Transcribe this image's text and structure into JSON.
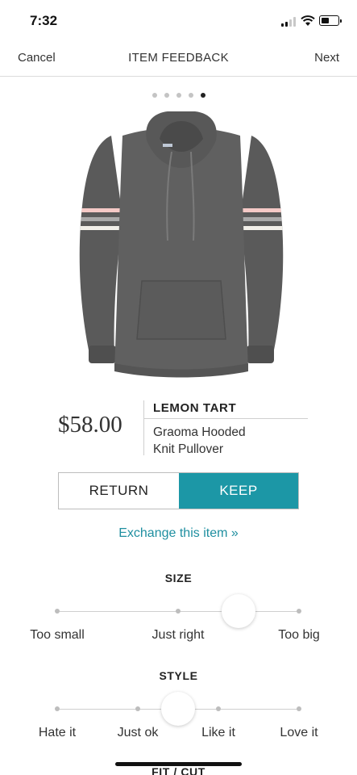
{
  "status_bar": {
    "time": "7:32"
  },
  "nav": {
    "cancel": "Cancel",
    "title": "ITEM FEEDBACK",
    "next": "Next"
  },
  "carousel": {
    "count": 5,
    "active_index": 4
  },
  "product": {
    "price": "$58.00",
    "brand": "LEMON TART",
    "name_line1": "Graoma Hooded",
    "name_line2": "Knit Pullover",
    "image_icon": "gray-hooded-pullover"
  },
  "actions": {
    "return_label": "RETURN",
    "keep_label": "KEEP",
    "selected": "KEEP",
    "exchange_link": "Exchange this item »"
  },
  "size": {
    "label": "SIZE",
    "options": [
      "Too small",
      "Just right",
      "Too big"
    ],
    "selected_fraction": 0.75
  },
  "style": {
    "label": "STYLE",
    "options": [
      "Hate it",
      "Just ok",
      "Like it",
      "Love it"
    ],
    "selected_fraction": 0.5
  },
  "fit_cut": {
    "label": "FIT / CUT"
  },
  "colors": {
    "accent": "#1c97a6",
    "link": "#1f8fa0",
    "garment": "#5a5a5a",
    "stripe_pink": "#f4c9c6"
  }
}
